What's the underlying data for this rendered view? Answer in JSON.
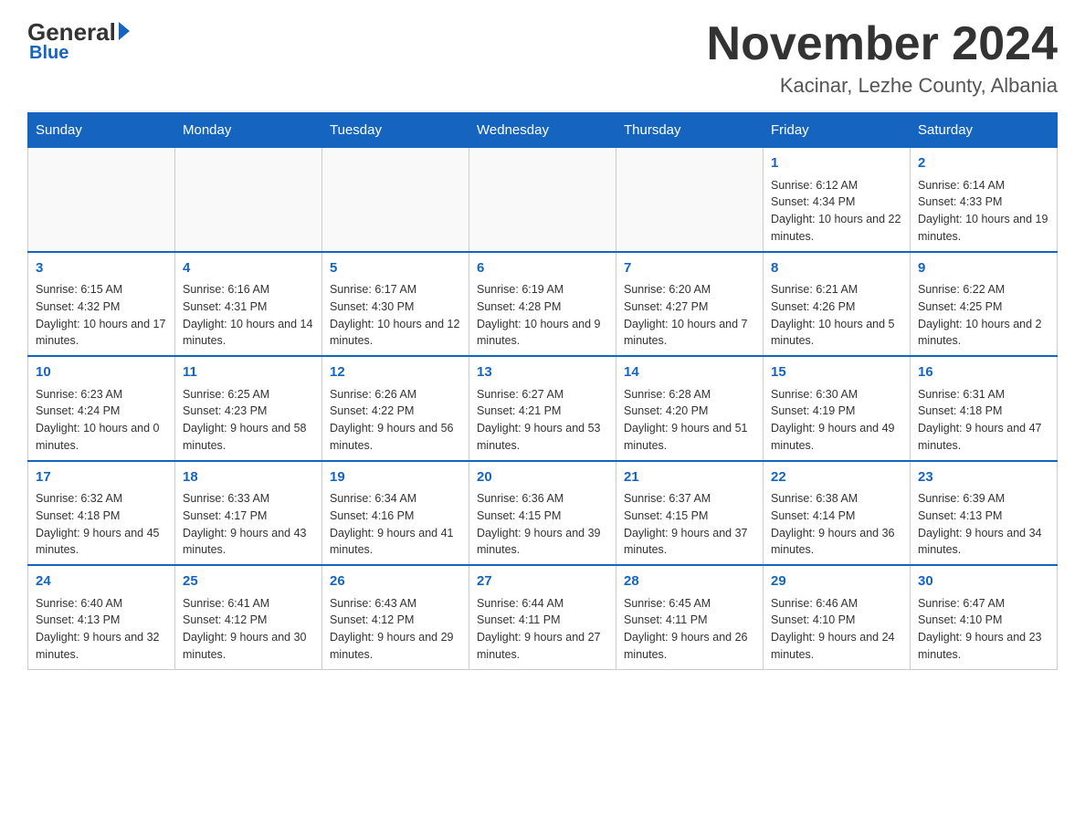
{
  "logo": {
    "general": "General",
    "blue": "Blue"
  },
  "title": "November 2024",
  "subtitle": "Kacinar, Lezhe County, Albania",
  "days_of_week": [
    "Sunday",
    "Monday",
    "Tuesday",
    "Wednesday",
    "Thursday",
    "Friday",
    "Saturday"
  ],
  "weeks": [
    [
      {
        "day": "",
        "sunrise": "",
        "sunset": "",
        "daylight": ""
      },
      {
        "day": "",
        "sunrise": "",
        "sunset": "",
        "daylight": ""
      },
      {
        "day": "",
        "sunrise": "",
        "sunset": "",
        "daylight": ""
      },
      {
        "day": "",
        "sunrise": "",
        "sunset": "",
        "daylight": ""
      },
      {
        "day": "",
        "sunrise": "",
        "sunset": "",
        "daylight": ""
      },
      {
        "day": "1",
        "sunrise": "Sunrise: 6:12 AM",
        "sunset": "Sunset: 4:34 PM",
        "daylight": "Daylight: 10 hours and 22 minutes."
      },
      {
        "day": "2",
        "sunrise": "Sunrise: 6:14 AM",
        "sunset": "Sunset: 4:33 PM",
        "daylight": "Daylight: 10 hours and 19 minutes."
      }
    ],
    [
      {
        "day": "3",
        "sunrise": "Sunrise: 6:15 AM",
        "sunset": "Sunset: 4:32 PM",
        "daylight": "Daylight: 10 hours and 17 minutes."
      },
      {
        "day": "4",
        "sunrise": "Sunrise: 6:16 AM",
        "sunset": "Sunset: 4:31 PM",
        "daylight": "Daylight: 10 hours and 14 minutes."
      },
      {
        "day": "5",
        "sunrise": "Sunrise: 6:17 AM",
        "sunset": "Sunset: 4:30 PM",
        "daylight": "Daylight: 10 hours and 12 minutes."
      },
      {
        "day": "6",
        "sunrise": "Sunrise: 6:19 AM",
        "sunset": "Sunset: 4:28 PM",
        "daylight": "Daylight: 10 hours and 9 minutes."
      },
      {
        "day": "7",
        "sunrise": "Sunrise: 6:20 AM",
        "sunset": "Sunset: 4:27 PM",
        "daylight": "Daylight: 10 hours and 7 minutes."
      },
      {
        "day": "8",
        "sunrise": "Sunrise: 6:21 AM",
        "sunset": "Sunset: 4:26 PM",
        "daylight": "Daylight: 10 hours and 5 minutes."
      },
      {
        "day": "9",
        "sunrise": "Sunrise: 6:22 AM",
        "sunset": "Sunset: 4:25 PM",
        "daylight": "Daylight: 10 hours and 2 minutes."
      }
    ],
    [
      {
        "day": "10",
        "sunrise": "Sunrise: 6:23 AM",
        "sunset": "Sunset: 4:24 PM",
        "daylight": "Daylight: 10 hours and 0 minutes."
      },
      {
        "day": "11",
        "sunrise": "Sunrise: 6:25 AM",
        "sunset": "Sunset: 4:23 PM",
        "daylight": "Daylight: 9 hours and 58 minutes."
      },
      {
        "day": "12",
        "sunrise": "Sunrise: 6:26 AM",
        "sunset": "Sunset: 4:22 PM",
        "daylight": "Daylight: 9 hours and 56 minutes."
      },
      {
        "day": "13",
        "sunrise": "Sunrise: 6:27 AM",
        "sunset": "Sunset: 4:21 PM",
        "daylight": "Daylight: 9 hours and 53 minutes."
      },
      {
        "day": "14",
        "sunrise": "Sunrise: 6:28 AM",
        "sunset": "Sunset: 4:20 PM",
        "daylight": "Daylight: 9 hours and 51 minutes."
      },
      {
        "day": "15",
        "sunrise": "Sunrise: 6:30 AM",
        "sunset": "Sunset: 4:19 PM",
        "daylight": "Daylight: 9 hours and 49 minutes."
      },
      {
        "day": "16",
        "sunrise": "Sunrise: 6:31 AM",
        "sunset": "Sunset: 4:18 PM",
        "daylight": "Daylight: 9 hours and 47 minutes."
      }
    ],
    [
      {
        "day": "17",
        "sunrise": "Sunrise: 6:32 AM",
        "sunset": "Sunset: 4:18 PM",
        "daylight": "Daylight: 9 hours and 45 minutes."
      },
      {
        "day": "18",
        "sunrise": "Sunrise: 6:33 AM",
        "sunset": "Sunset: 4:17 PM",
        "daylight": "Daylight: 9 hours and 43 minutes."
      },
      {
        "day": "19",
        "sunrise": "Sunrise: 6:34 AM",
        "sunset": "Sunset: 4:16 PM",
        "daylight": "Daylight: 9 hours and 41 minutes."
      },
      {
        "day": "20",
        "sunrise": "Sunrise: 6:36 AM",
        "sunset": "Sunset: 4:15 PM",
        "daylight": "Daylight: 9 hours and 39 minutes."
      },
      {
        "day": "21",
        "sunrise": "Sunrise: 6:37 AM",
        "sunset": "Sunset: 4:15 PM",
        "daylight": "Daylight: 9 hours and 37 minutes."
      },
      {
        "day": "22",
        "sunrise": "Sunrise: 6:38 AM",
        "sunset": "Sunset: 4:14 PM",
        "daylight": "Daylight: 9 hours and 36 minutes."
      },
      {
        "day": "23",
        "sunrise": "Sunrise: 6:39 AM",
        "sunset": "Sunset: 4:13 PM",
        "daylight": "Daylight: 9 hours and 34 minutes."
      }
    ],
    [
      {
        "day": "24",
        "sunrise": "Sunrise: 6:40 AM",
        "sunset": "Sunset: 4:13 PM",
        "daylight": "Daylight: 9 hours and 32 minutes."
      },
      {
        "day": "25",
        "sunrise": "Sunrise: 6:41 AM",
        "sunset": "Sunset: 4:12 PM",
        "daylight": "Daylight: 9 hours and 30 minutes."
      },
      {
        "day": "26",
        "sunrise": "Sunrise: 6:43 AM",
        "sunset": "Sunset: 4:12 PM",
        "daylight": "Daylight: 9 hours and 29 minutes."
      },
      {
        "day": "27",
        "sunrise": "Sunrise: 6:44 AM",
        "sunset": "Sunset: 4:11 PM",
        "daylight": "Daylight: 9 hours and 27 minutes."
      },
      {
        "day": "28",
        "sunrise": "Sunrise: 6:45 AM",
        "sunset": "Sunset: 4:11 PM",
        "daylight": "Daylight: 9 hours and 26 minutes."
      },
      {
        "day": "29",
        "sunrise": "Sunrise: 6:46 AM",
        "sunset": "Sunset: 4:10 PM",
        "daylight": "Daylight: 9 hours and 24 minutes."
      },
      {
        "day": "30",
        "sunrise": "Sunrise: 6:47 AM",
        "sunset": "Sunset: 4:10 PM",
        "daylight": "Daylight: 9 hours and 23 minutes."
      }
    ]
  ]
}
